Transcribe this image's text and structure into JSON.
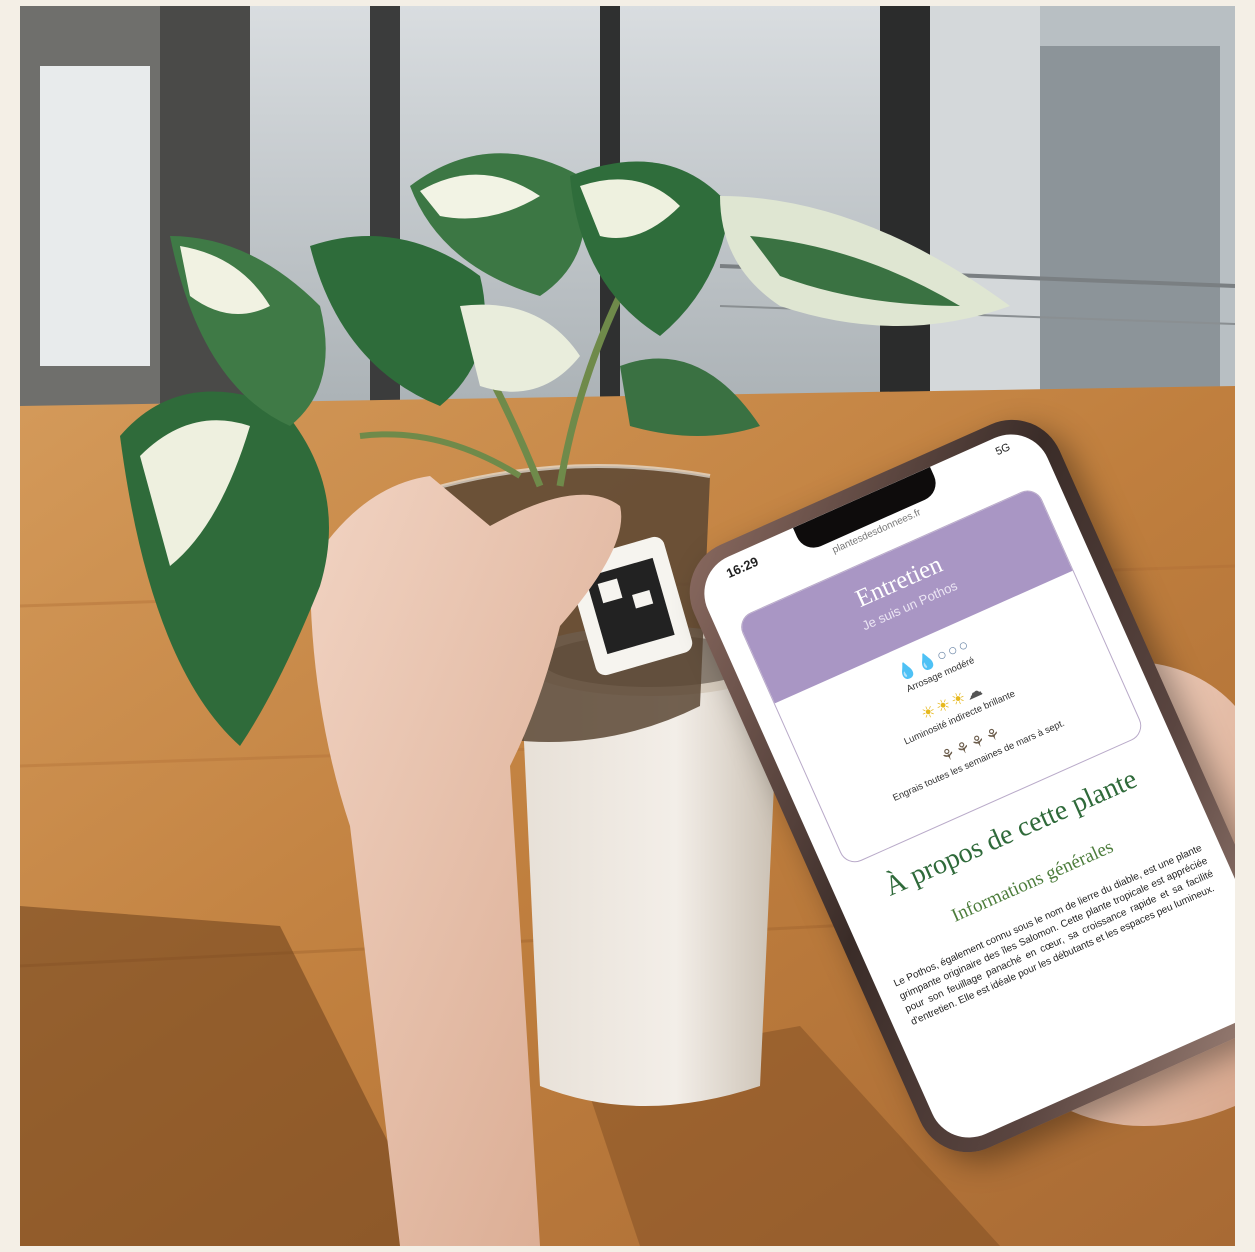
{
  "phone": {
    "status": {
      "time": "16:29",
      "signal": "5G"
    },
    "url": "plantesdesdonnees.fr",
    "care_card": {
      "title": "Entretien",
      "subtitle": "Je suis un Pothos",
      "rows": [
        {
          "icon": "water-drop-icon",
          "filled": 2,
          "total": 5,
          "label": "Arrosage modéré"
        },
        {
          "icon": "sun-icon",
          "filled": 3,
          "total": 4,
          "label": "Luminosité indirecte brillante"
        },
        {
          "icon": "fertilizer-icon",
          "filled": 4,
          "total": 4,
          "label": "Engrais toutes les semaines de mars à sept."
        }
      ]
    },
    "about_title": "À propos de cette plante",
    "info_title": "Informations générales",
    "info_text": "Le Pothos, également connu sous le nom de lierre du diable, est une plante grimpante originaire des îles Salomon. Cette plante tropicale est appréciée pour son feuillage panaché en cœur, sa croissance rapide et sa facilité d'entretien. Elle est idéale pour les débutants et les espaces peu lumineux."
  },
  "colors": {
    "card_header": "#a996c4",
    "title_green": "#2f6a3a",
    "water_blue": "#2f74c2",
    "sun_yellow": "#e6b81d"
  }
}
